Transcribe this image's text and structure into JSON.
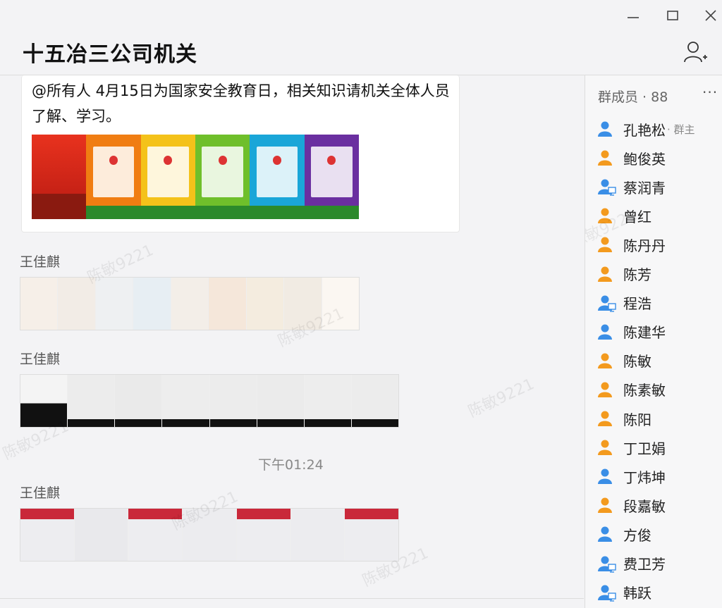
{
  "window": {
    "title": "十五冶三公司机关"
  },
  "chat": {
    "pinned_message": {
      "text": "@所有人  4月15日为国家安全教育日，相关知识请机关全体人员了解、学习。",
      "poster_colors": [
        "#d62a1e",
        "#f07d12",
        "#f4c21a",
        "#6fbf2b",
        "#1aa6d8",
        "#6a2fa0"
      ]
    },
    "messages": [
      {
        "sender": "王佳麒"
      },
      {
        "sender": "王佳麒"
      },
      {
        "sender": "王佳麒"
      }
    ],
    "timestamp": "下午01:24",
    "watermark": "陈敏9221"
  },
  "members": {
    "header": "群成员 · 88",
    "more_label": "···",
    "list": [
      {
        "name": "孔艳松",
        "role": "· 群主",
        "avatar": "blue"
      },
      {
        "name": "鲍俊英",
        "role": "",
        "avatar": "orange"
      },
      {
        "name": "蔡润青",
        "role": "",
        "avatar": "blue-pc"
      },
      {
        "name": "曾红",
        "role": "",
        "avatar": "orange"
      },
      {
        "name": "陈丹丹",
        "role": "",
        "avatar": "orange"
      },
      {
        "name": "陈芳",
        "role": "",
        "avatar": "orange"
      },
      {
        "name": "程浩",
        "role": "",
        "avatar": "blue-pc"
      },
      {
        "name": "陈建华",
        "role": "",
        "avatar": "blue"
      },
      {
        "name": "陈敏",
        "role": "",
        "avatar": "orange"
      },
      {
        "name": "陈素敏",
        "role": "",
        "avatar": "orange"
      },
      {
        "name": "陈阳",
        "role": "",
        "avatar": "orange"
      },
      {
        "name": "丁卫娟",
        "role": "",
        "avatar": "orange"
      },
      {
        "name": "丁炜坤",
        "role": "",
        "avatar": "blue"
      },
      {
        "name": "段嘉敏",
        "role": "",
        "avatar": "orange"
      },
      {
        "name": "方俊",
        "role": "",
        "avatar": "blue"
      },
      {
        "name": "费卫芳",
        "role": "",
        "avatar": "blue-pc"
      },
      {
        "name": "韩跃",
        "role": "",
        "avatar": "blue-pc"
      }
    ]
  },
  "colors": {
    "accent_blue": "#3a8ee6",
    "accent_orange": "#f39a1e"
  }
}
